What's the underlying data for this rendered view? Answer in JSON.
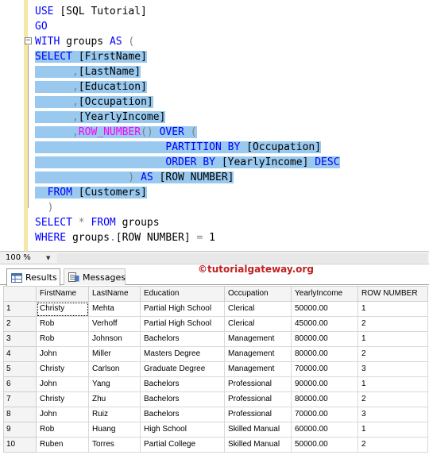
{
  "editor": {
    "lines": [
      [
        {
          "t": "USE ",
          "c": "kw"
        },
        {
          "t": "[SQL Tutorial]",
          "c": "tx"
        }
      ],
      [
        {
          "t": "GO",
          "c": "kw"
        }
      ],
      [
        {
          "t": "WITH ",
          "c": "kw"
        },
        {
          "t": "groups ",
          "c": "tx"
        },
        {
          "t": "AS",
          "c": "kw"
        },
        {
          "t": " (",
          "c": "op"
        }
      ],
      [
        {
          "t": "SELECT ",
          "c": "kw",
          "s": 1
        },
        {
          "t": "[FirstName]",
          "c": "tx",
          "s": 1
        }
      ],
      [
        {
          "t": "      ",
          "c": "tx",
          "s": 1
        },
        {
          "t": ",",
          "c": "op",
          "s": 1
        },
        {
          "t": "[LastName]",
          "c": "tx",
          "s": 1
        }
      ],
      [
        {
          "t": "      ",
          "c": "tx",
          "s": 1
        },
        {
          "t": ",",
          "c": "op",
          "s": 1
        },
        {
          "t": "[Education]",
          "c": "tx",
          "s": 1
        }
      ],
      [
        {
          "t": "      ",
          "c": "tx",
          "s": 1
        },
        {
          "t": ",",
          "c": "op",
          "s": 1
        },
        {
          "t": "[Occupation]",
          "c": "tx",
          "s": 1
        }
      ],
      [
        {
          "t": "      ",
          "c": "tx",
          "s": 1
        },
        {
          "t": ",",
          "c": "op",
          "s": 1
        },
        {
          "t": "[YearlyIncome]",
          "c": "tx",
          "s": 1
        }
      ],
      [
        {
          "t": "      ",
          "c": "tx",
          "s": 1
        },
        {
          "t": ",",
          "c": "op",
          "s": 1
        },
        {
          "t": "ROW_NUMBER",
          "c": "fn",
          "s": 1
        },
        {
          "t": "() ",
          "c": "op",
          "s": 1
        },
        {
          "t": "OVER",
          "c": "kw",
          "s": 1
        },
        {
          "t": " (",
          "c": "op",
          "s": 1
        }
      ],
      [
        {
          "t": "                     ",
          "c": "tx",
          "s": 1
        },
        {
          "t": "PARTITION BY ",
          "c": "kw",
          "s": 1
        },
        {
          "t": "[Occupation]",
          "c": "tx",
          "s": 1
        }
      ],
      [
        {
          "t": "                     ",
          "c": "tx",
          "s": 1
        },
        {
          "t": "ORDER BY ",
          "c": "kw",
          "s": 1
        },
        {
          "t": "[YearlyIncome] ",
          "c": "tx",
          "s": 1
        },
        {
          "t": "DESC",
          "c": "kw",
          "s": 1
        }
      ],
      [
        {
          "t": "               ",
          "c": "tx",
          "s": 1
        },
        {
          "t": ") ",
          "c": "op",
          "s": 1
        },
        {
          "t": "AS ",
          "c": "kw",
          "s": 1
        },
        {
          "t": "[ROW NUMBER]",
          "c": "tx",
          "s": 1
        }
      ],
      [
        {
          "t": "  ",
          "c": "tx",
          "s": 1
        },
        {
          "t": "FROM ",
          "c": "kw",
          "s": 1
        },
        {
          "t": "[Customers]",
          "c": "tx",
          "s": 1
        }
      ],
      [
        {
          "t": "  ",
          "c": "tx"
        },
        {
          "t": ")",
          "c": "op"
        }
      ],
      [
        {
          "t": "SELECT ",
          "c": "kw"
        },
        {
          "t": "* ",
          "c": "op"
        },
        {
          "t": "FROM ",
          "c": "kw"
        },
        {
          "t": "groups",
          "c": "tx"
        }
      ],
      [
        {
          "t": "WHERE ",
          "c": "kw"
        },
        {
          "t": "groups",
          "c": "tx"
        },
        {
          "t": ".",
          "c": "op"
        },
        {
          "t": "[ROW NUMBER] ",
          "c": "tx"
        },
        {
          "t": "= ",
          "c": "op"
        },
        {
          "t": "1",
          "c": "tx"
        }
      ]
    ]
  },
  "zoom": {
    "value": "100 %",
    "arrow": "▼"
  },
  "tabs": {
    "results": "Results",
    "messages": "Messages"
  },
  "watermark": "©tutorialgateway.org",
  "grid": {
    "columns": [
      "",
      "FirstName",
      "LastName",
      "Education",
      "Occupation",
      "YearlyIncome",
      "ROW NUMBER"
    ],
    "rows": [
      [
        "1",
        "Christy",
        "Mehta",
        "Partial High School",
        "Clerical",
        "50000.00",
        "1"
      ],
      [
        "2",
        "Rob",
        "Verhoff",
        "Partial High School",
        "Clerical",
        "45000.00",
        "2"
      ],
      [
        "3",
        "Rob",
        "Johnson",
        "Bachelors",
        "Management",
        "80000.00",
        "1"
      ],
      [
        "4",
        "John",
        "Miller",
        "Masters Degree",
        "Management",
        "80000.00",
        "2"
      ],
      [
        "5",
        "Christy",
        "Carlson",
        "Graduate Degree",
        "Management",
        "70000.00",
        "3"
      ],
      [
        "6",
        "John",
        "Yang",
        "Bachelors",
        "Professional",
        "90000.00",
        "1"
      ],
      [
        "7",
        "Christy",
        "Zhu",
        "Bachelors",
        "Professional",
        "80000.00",
        "2"
      ],
      [
        "8",
        "John",
        "Ruiz",
        "Bachelors",
        "Professional",
        "70000.00",
        "3"
      ],
      [
        "9",
        "Rob",
        "Huang",
        "High School",
        "Skilled Manual",
        "60000.00",
        "1"
      ],
      [
        "10",
        "Ruben",
        "Torres",
        "Partial College",
        "Skilled Manual",
        "50000.00",
        "2"
      ]
    ]
  }
}
